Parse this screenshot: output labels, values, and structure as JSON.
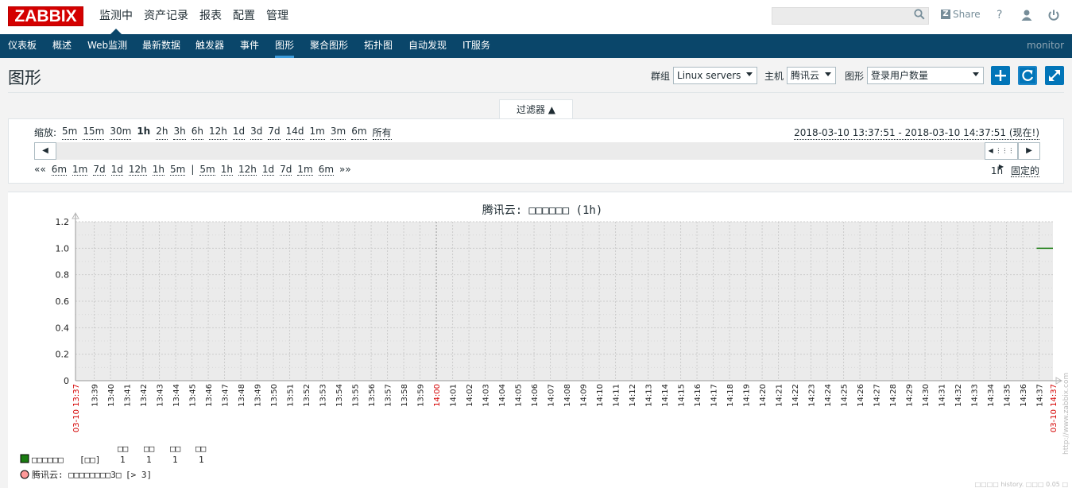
{
  "top": {
    "logo": "ZABBIX",
    "menu": [
      "监测中",
      "资产记录",
      "报表",
      "配置",
      "管理"
    ],
    "share": "Share",
    "help_icon": "?",
    "colors": {
      "logo": "#d40000",
      "subbar": "#0a466a",
      "accent": "#3a9ad9"
    }
  },
  "sub": {
    "items": [
      "仪表板",
      "概述",
      "Web监测",
      "最新数据",
      "触发器",
      "事件",
      "图形",
      "聚合图形",
      "拓扑图",
      "自动发现",
      "IT服务"
    ],
    "active": "图形",
    "user": "monitor"
  },
  "page": {
    "title": "图形",
    "group_label": "群组",
    "group_value": "Linux servers",
    "host_label": "主机",
    "host_value": "腾讯云",
    "graph_label": "图形",
    "graph_value": "登录用户数量"
  },
  "filter": {
    "tab": "过滤器 ▲",
    "zoom_label": "缩放:",
    "zoom": [
      "5m",
      "15m",
      "30m",
      "1h",
      "2h",
      "3h",
      "6h",
      "12h",
      "1d",
      "3d",
      "7d",
      "14d",
      "1m",
      "3m",
      "6m",
      "所有"
    ],
    "zoom_active": "1h",
    "period": "2018-03-10 13:37:51 - 2018-03-10 14:37:51 (现在!)",
    "back": [
      "««",
      "6m",
      "1m",
      "7d",
      "1d",
      "12h",
      "1h",
      "5m"
    ],
    "sep": "|",
    "fwd": [
      "5m",
      "1h",
      "12h",
      "1d",
      "7d",
      "1m",
      "6m",
      "»»"
    ],
    "len": "1h",
    "fixed": "固定的"
  },
  "graph": {
    "title": "腾讯云: □□□□□□ (1h)",
    "watermark": "http://www.zabbix.com",
    "footer": "□□□□ history. □□□ 0.05 □",
    "legend": {
      "headers": [
        "□□",
        "□□",
        "□□",
        "□□"
      ],
      "item_name": "□□□□□□",
      "item_func": "[□□]",
      "item_values": [
        "1",
        "1",
        "1",
        "1"
      ],
      "trigger": "腾讯云: □□□□□□□□3□",
      "trigger_cond": "[> 3]",
      "item_color": "#1a7c11",
      "trigger_color": "#ff9999"
    }
  },
  "chart_data": {
    "type": "line",
    "title": "腾讯云: □□□□□□ (1h)",
    "xlabel": "",
    "ylabel": "",
    "ylim": [
      0,
      1.2
    ],
    "yticks": [
      "1.2",
      "1.0",
      "0.8",
      "0.6",
      "0.4",
      "0.2",
      "0"
    ],
    "xticks": [
      "03-10 13:37",
      "13:39",
      "13:40",
      "13:41",
      "13:42",
      "13:43",
      "13:44",
      "13:45",
      "13:46",
      "13:47",
      "13:48",
      "13:49",
      "13:50",
      "13:51",
      "13:52",
      "13:53",
      "13:54",
      "13:55",
      "13:56",
      "13:57",
      "13:58",
      "13:59",
      "14:00",
      "14:01",
      "14:02",
      "14:03",
      "14:04",
      "14:05",
      "14:06",
      "14:07",
      "14:08",
      "14:09",
      "14:10",
      "14:11",
      "14:12",
      "14:13",
      "14:14",
      "14:15",
      "14:16",
      "14:17",
      "14:18",
      "14:19",
      "14:20",
      "14:21",
      "14:22",
      "14:23",
      "14:24",
      "14:25",
      "14:26",
      "14:27",
      "14:28",
      "14:29",
      "14:30",
      "14:31",
      "14:32",
      "14:33",
      "14:34",
      "14:35",
      "14:36",
      "14:37",
      "03-10 14:37"
    ],
    "series": [
      {
        "name": "□□□□□□",
        "x": [
          "14:36:51",
          "14:37:51"
        ],
        "values": [
          1,
          1
        ],
        "color": "#1a7c11"
      }
    ],
    "grid": true
  }
}
